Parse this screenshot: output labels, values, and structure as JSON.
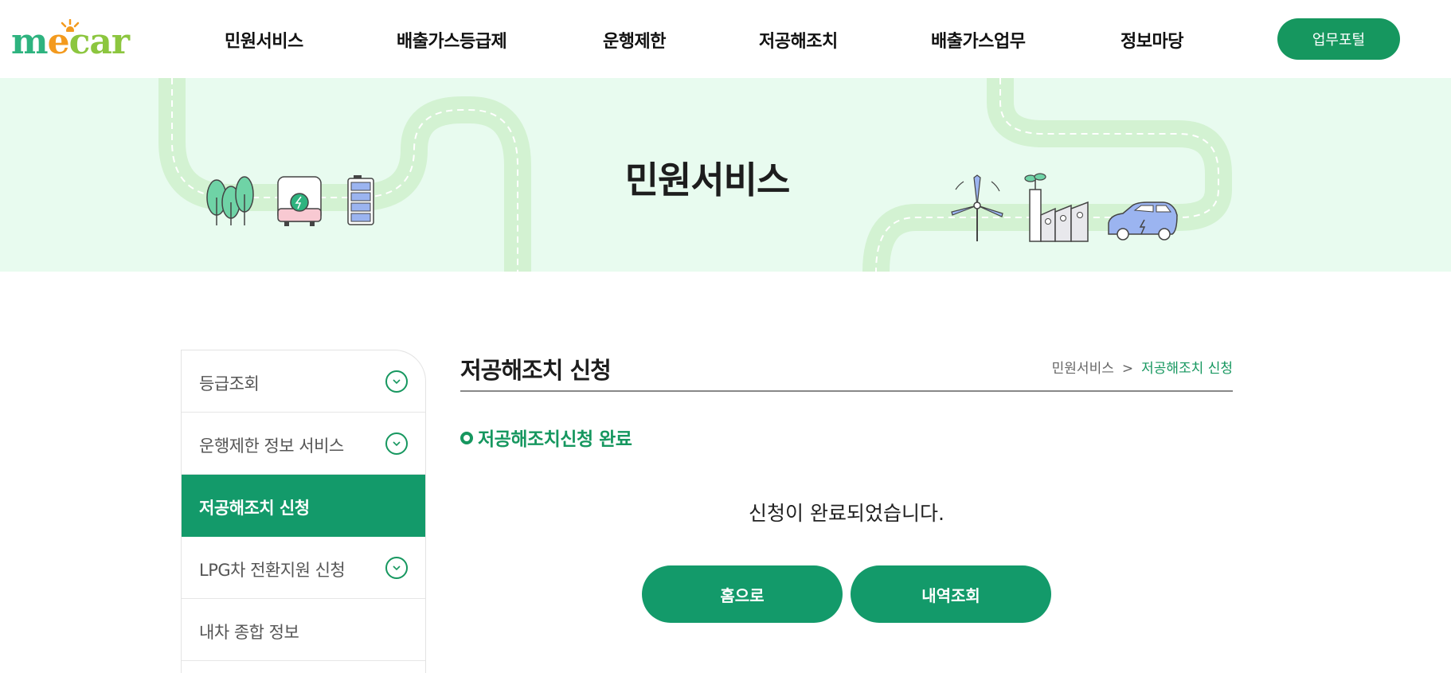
{
  "header": {
    "logo": "mecar",
    "nav": [
      "민원서비스",
      "배출가스등급제",
      "운행제한",
      "저공해조치",
      "배출가스업무",
      "정보마당"
    ],
    "portal_button": "업무포털"
  },
  "banner": {
    "title": "민원서비스"
  },
  "sidebar": {
    "items": [
      {
        "label": "등급조회",
        "active": false,
        "expandable": true
      },
      {
        "label": "운행제한 정보 서비스",
        "active": false,
        "expandable": true
      },
      {
        "label": "저공해조치 신청",
        "active": true,
        "expandable": false
      },
      {
        "label": "LPG차 전환지원 신청",
        "active": false,
        "expandable": true
      },
      {
        "label": "내차 종합 정보",
        "active": false,
        "expandable": false
      }
    ]
  },
  "main": {
    "title": "저공해조치 신청",
    "breadcrumb": {
      "parent": "민원서비스",
      "separator": ">",
      "current": "저공해조치 신청"
    },
    "section_title": "저공해조치신청 완료",
    "message": "신청이 완료되었습니다.",
    "buttons": {
      "home": "홈으로",
      "history": "내역조회"
    }
  },
  "colors": {
    "accent": "#16975f",
    "banner_bg": "#e8fbef",
    "road": "#d3f2d2"
  }
}
